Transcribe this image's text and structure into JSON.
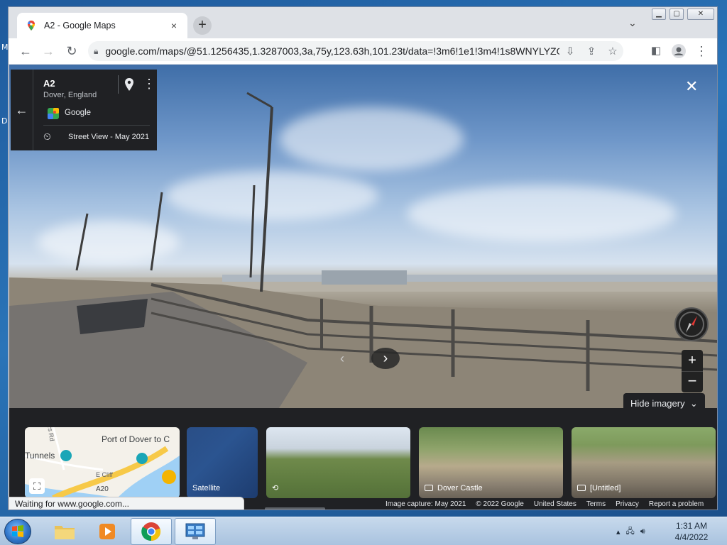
{
  "browser": {
    "tab_title": "A2 - Google Maps",
    "tab_close": "×",
    "new_tab": "+",
    "url": "google.com/maps/@51.1256435,1.3287003,3a,75y,123.63h,101.23t/data=!3m6!1e1!3m4!1s8WNYLYZO...",
    "status_text": "Waiting for www.google.com..."
  },
  "infocard": {
    "title": "A2",
    "subtitle": "Dover, England",
    "provider": "Google",
    "date": "Street View - May 2021"
  },
  "controls": {
    "hide_imagery": "Hide imagery",
    "zoom_in": "+",
    "zoom_out": "−"
  },
  "thumbnails": {
    "map_label_1": "Port of Dover to C",
    "map_label_2": "Tunnels",
    "map_label_3": "E Cliff",
    "map_label_4": "A20",
    "map_label_5": "rs Rd",
    "satellite": "Satellite",
    "castle": "Dover Castle",
    "untitled": "[Untitled]"
  },
  "footer": {
    "capture": "Image capture: May 2021",
    "copyright": "© 2022 Google",
    "country": "United States",
    "terms": "Terms",
    "privacy": "Privacy",
    "report": "Report a problem"
  },
  "desktop": {
    "letter1": "M",
    "letter2": "D"
  },
  "taskbar": {
    "time": "1:31 AM",
    "date": "4/4/2022"
  },
  "colors": {
    "maps_panel": "#202124",
    "chrome_frame": "#dee1e6",
    "taskbar": "#a9c3df"
  }
}
